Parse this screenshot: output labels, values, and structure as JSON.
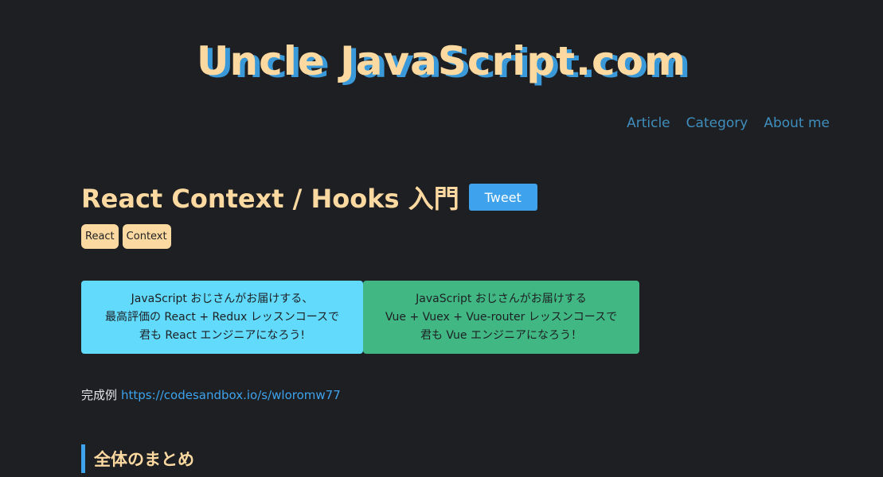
{
  "site": {
    "title": "Uncle JavaScript.com"
  },
  "nav": {
    "items": [
      "Article",
      "Category",
      "About me"
    ]
  },
  "article": {
    "title": "React Context / Hooks 入門",
    "tweet_label": "Tweet",
    "tags": [
      "React",
      "Context"
    ]
  },
  "banners": {
    "react": {
      "lines": [
        "JavaScript おじさんがお届けする、",
        "最高評価の React + Redux レッスンコースで",
        "君も React エンジニアになろう!"
      ]
    },
    "vue": {
      "lines": [
        "JavaScript おじさんがお届けする",
        "Vue + Vuex + Vue-router レッスンコースで",
        "君も Vue エンジニアになろう！"
      ]
    }
  },
  "example": {
    "label": "完成例",
    "link_text": "https://codesandbox.io/s/wloromw77"
  },
  "section": {
    "heading": "全体のまとめ"
  },
  "colors": {
    "background": "#1d1f23",
    "accent_peach": "#fcd9a0",
    "accent_blue": "#3ea3ec",
    "react_banner": "#61dafb",
    "vue_banner": "#41b883"
  }
}
